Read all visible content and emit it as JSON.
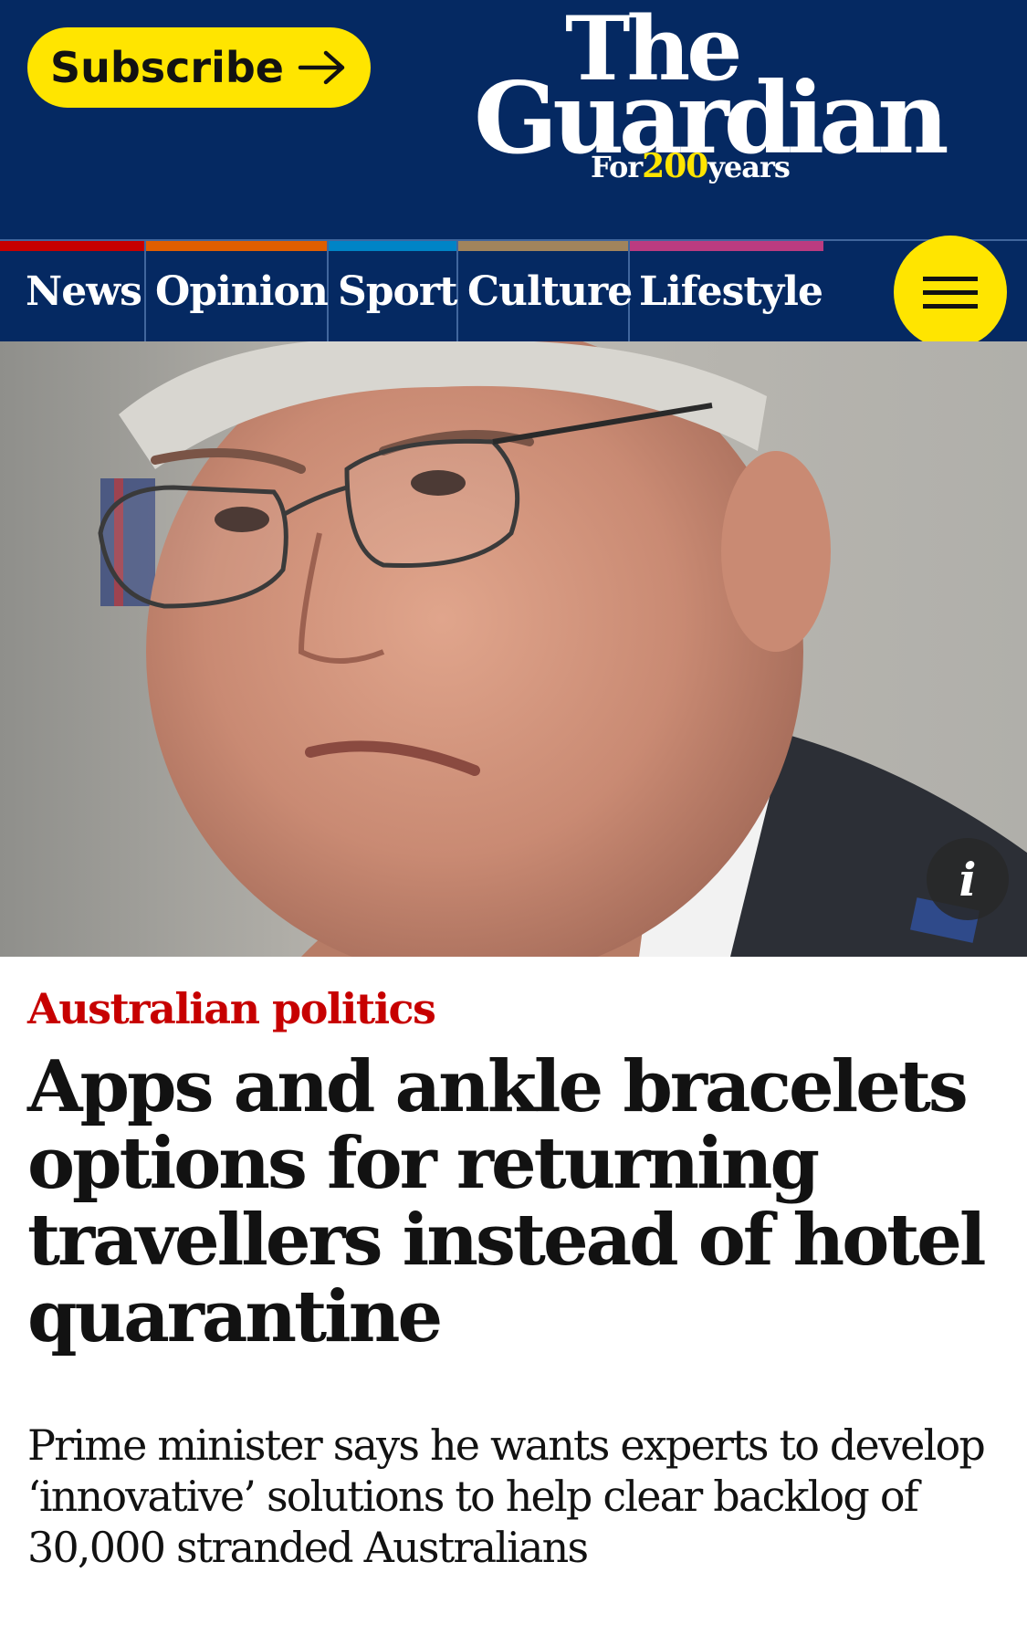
{
  "header": {
    "subscribe_label": "Subscribe",
    "logo_the": "The",
    "logo_guardian": "Guardian",
    "tagline_prefix": "For",
    "tagline_number": "200",
    "tagline_suffix": "years",
    "background_color": "#052962",
    "accent_color": "#ffe500"
  },
  "nav": {
    "items": [
      {
        "label": "News",
        "color": "#c70000"
      },
      {
        "label": "Opinion",
        "color": "#e05e00"
      },
      {
        "label": "Sport",
        "color": "#0084c6"
      },
      {
        "label": "Culture",
        "color": "#a1845c"
      },
      {
        "label": "Lifestyle",
        "color": "#bb3b80"
      }
    ],
    "menu_icon": "hamburger-icon"
  },
  "hero": {
    "info_label": "i",
    "info_icon": "info-icon"
  },
  "article": {
    "kicker": "Australian politics",
    "kicker_color": "#c70000",
    "headline": "Apps and ankle bracelets options for returning travellers instead of hotel quarantine",
    "standfirst": "Prime minister says he wants experts to develop ‘innovative’ solutions to help clear backlog of 30,000 stranded Australians"
  }
}
